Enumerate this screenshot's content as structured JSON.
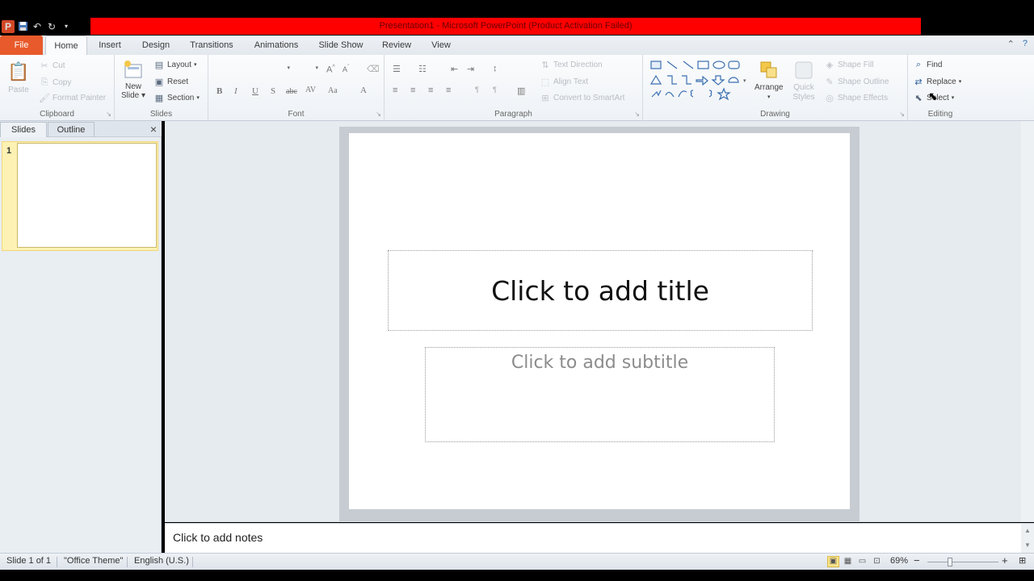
{
  "window": {
    "title": "Presentation1 - Microsoft PowerPoint (Product Activation Failed)",
    "title_color": "#ff0000"
  },
  "quick_access": {
    "items": [
      "powerpoint-logo",
      "save-icon",
      "undo-icon",
      "redo-icon",
      "customize-icon"
    ],
    "logo_letter": "P"
  },
  "tabs": {
    "file": "File",
    "items": [
      "Home",
      "Insert",
      "Design",
      "Transitions",
      "Animations",
      "Slide Show",
      "Review",
      "View"
    ],
    "active": "Home",
    "file_color": "#e85a2c"
  },
  "ribbon": {
    "clipboard": {
      "label": "Clipboard",
      "paste": "Paste",
      "cut": "Cut",
      "copy": "Copy",
      "format_painter": "Format Painter"
    },
    "slides": {
      "label": "Slides",
      "new_slide": "New",
      "new_slide_2": "Slide",
      "layout": "Layout",
      "reset": "Reset",
      "section": "Section"
    },
    "font": {
      "label": "Font",
      "buttons": [
        "B",
        "I",
        "U",
        "S",
        "abc",
        "AV",
        "Aa",
        "A"
      ]
    },
    "paragraph": {
      "label": "Paragraph",
      "text_direction": "Text Direction",
      "align_text": "Align Text",
      "convert_smartart": "Convert to SmartArt"
    },
    "drawing": {
      "label": "Drawing",
      "arrange": "Arrange",
      "quick_styles": "Quick",
      "quick_styles_2": "Styles",
      "shape_fill": "Shape Fill",
      "shape_outline": "Shape Outline",
      "shape_effects": "Shape Effects"
    },
    "editing": {
      "label": "Editing",
      "find": "Find",
      "replace": "Replace",
      "select": "Select"
    }
  },
  "slides_panel": {
    "tab_slides": "Slides",
    "tab_outline": "Outline",
    "close": "×",
    "slide_number": "1"
  },
  "slide": {
    "title_placeholder": "Click to add title",
    "subtitle_placeholder": "Click to add subtitle"
  },
  "notes": {
    "placeholder": "Click to add notes"
  },
  "status": {
    "slide_count": "Slide 1 of 1",
    "theme": "\"Office Theme\"",
    "language": "English (U.S.)",
    "zoom": "69%",
    "zoom_out": "−",
    "zoom_in": "+"
  }
}
